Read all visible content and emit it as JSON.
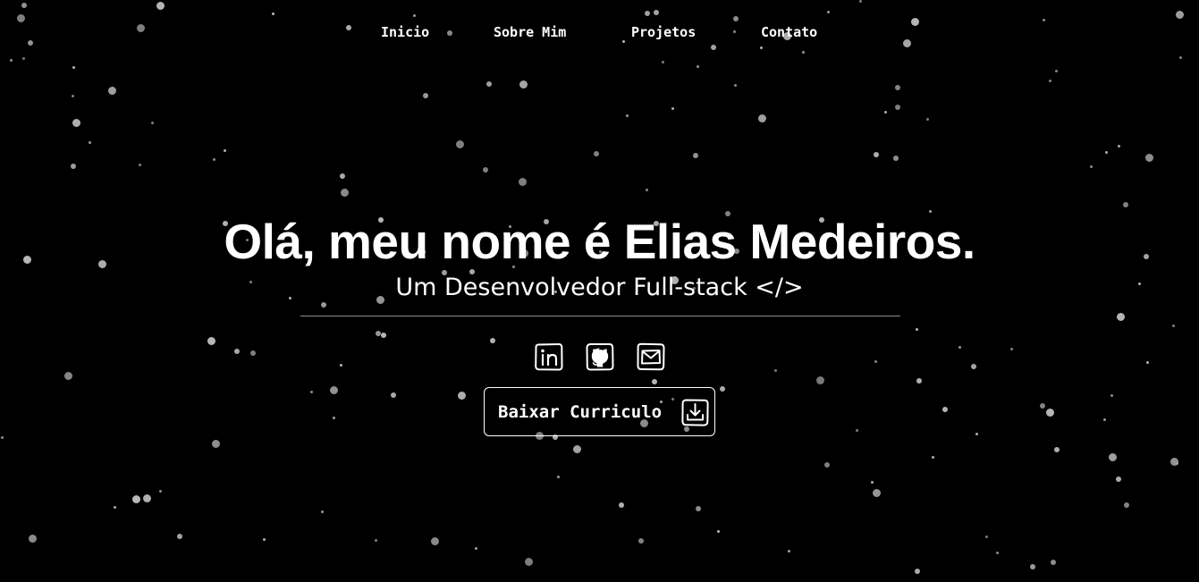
{
  "nav": {
    "items": [
      {
        "label": "Inicio"
      },
      {
        "label": "Sobre Mim"
      },
      {
        "label": "Projetos"
      },
      {
        "label": "Contato"
      }
    ]
  },
  "hero": {
    "title": "Olá, meu nome é Elias Medeiros.",
    "subtitle": "Um Desenvolvedor Full-stack </>"
  },
  "socials": [
    {
      "icon": "linkedin-icon"
    },
    {
      "icon": "github-icon"
    },
    {
      "icon": "mail-icon"
    }
  ],
  "cv_button": {
    "label": "Baixar Curriculo",
    "icon": "download-icon"
  },
  "colors": {
    "background": "#000000",
    "text": "#ffffff",
    "star": "#b8b8b8",
    "divider": "#8a8a8a"
  }
}
